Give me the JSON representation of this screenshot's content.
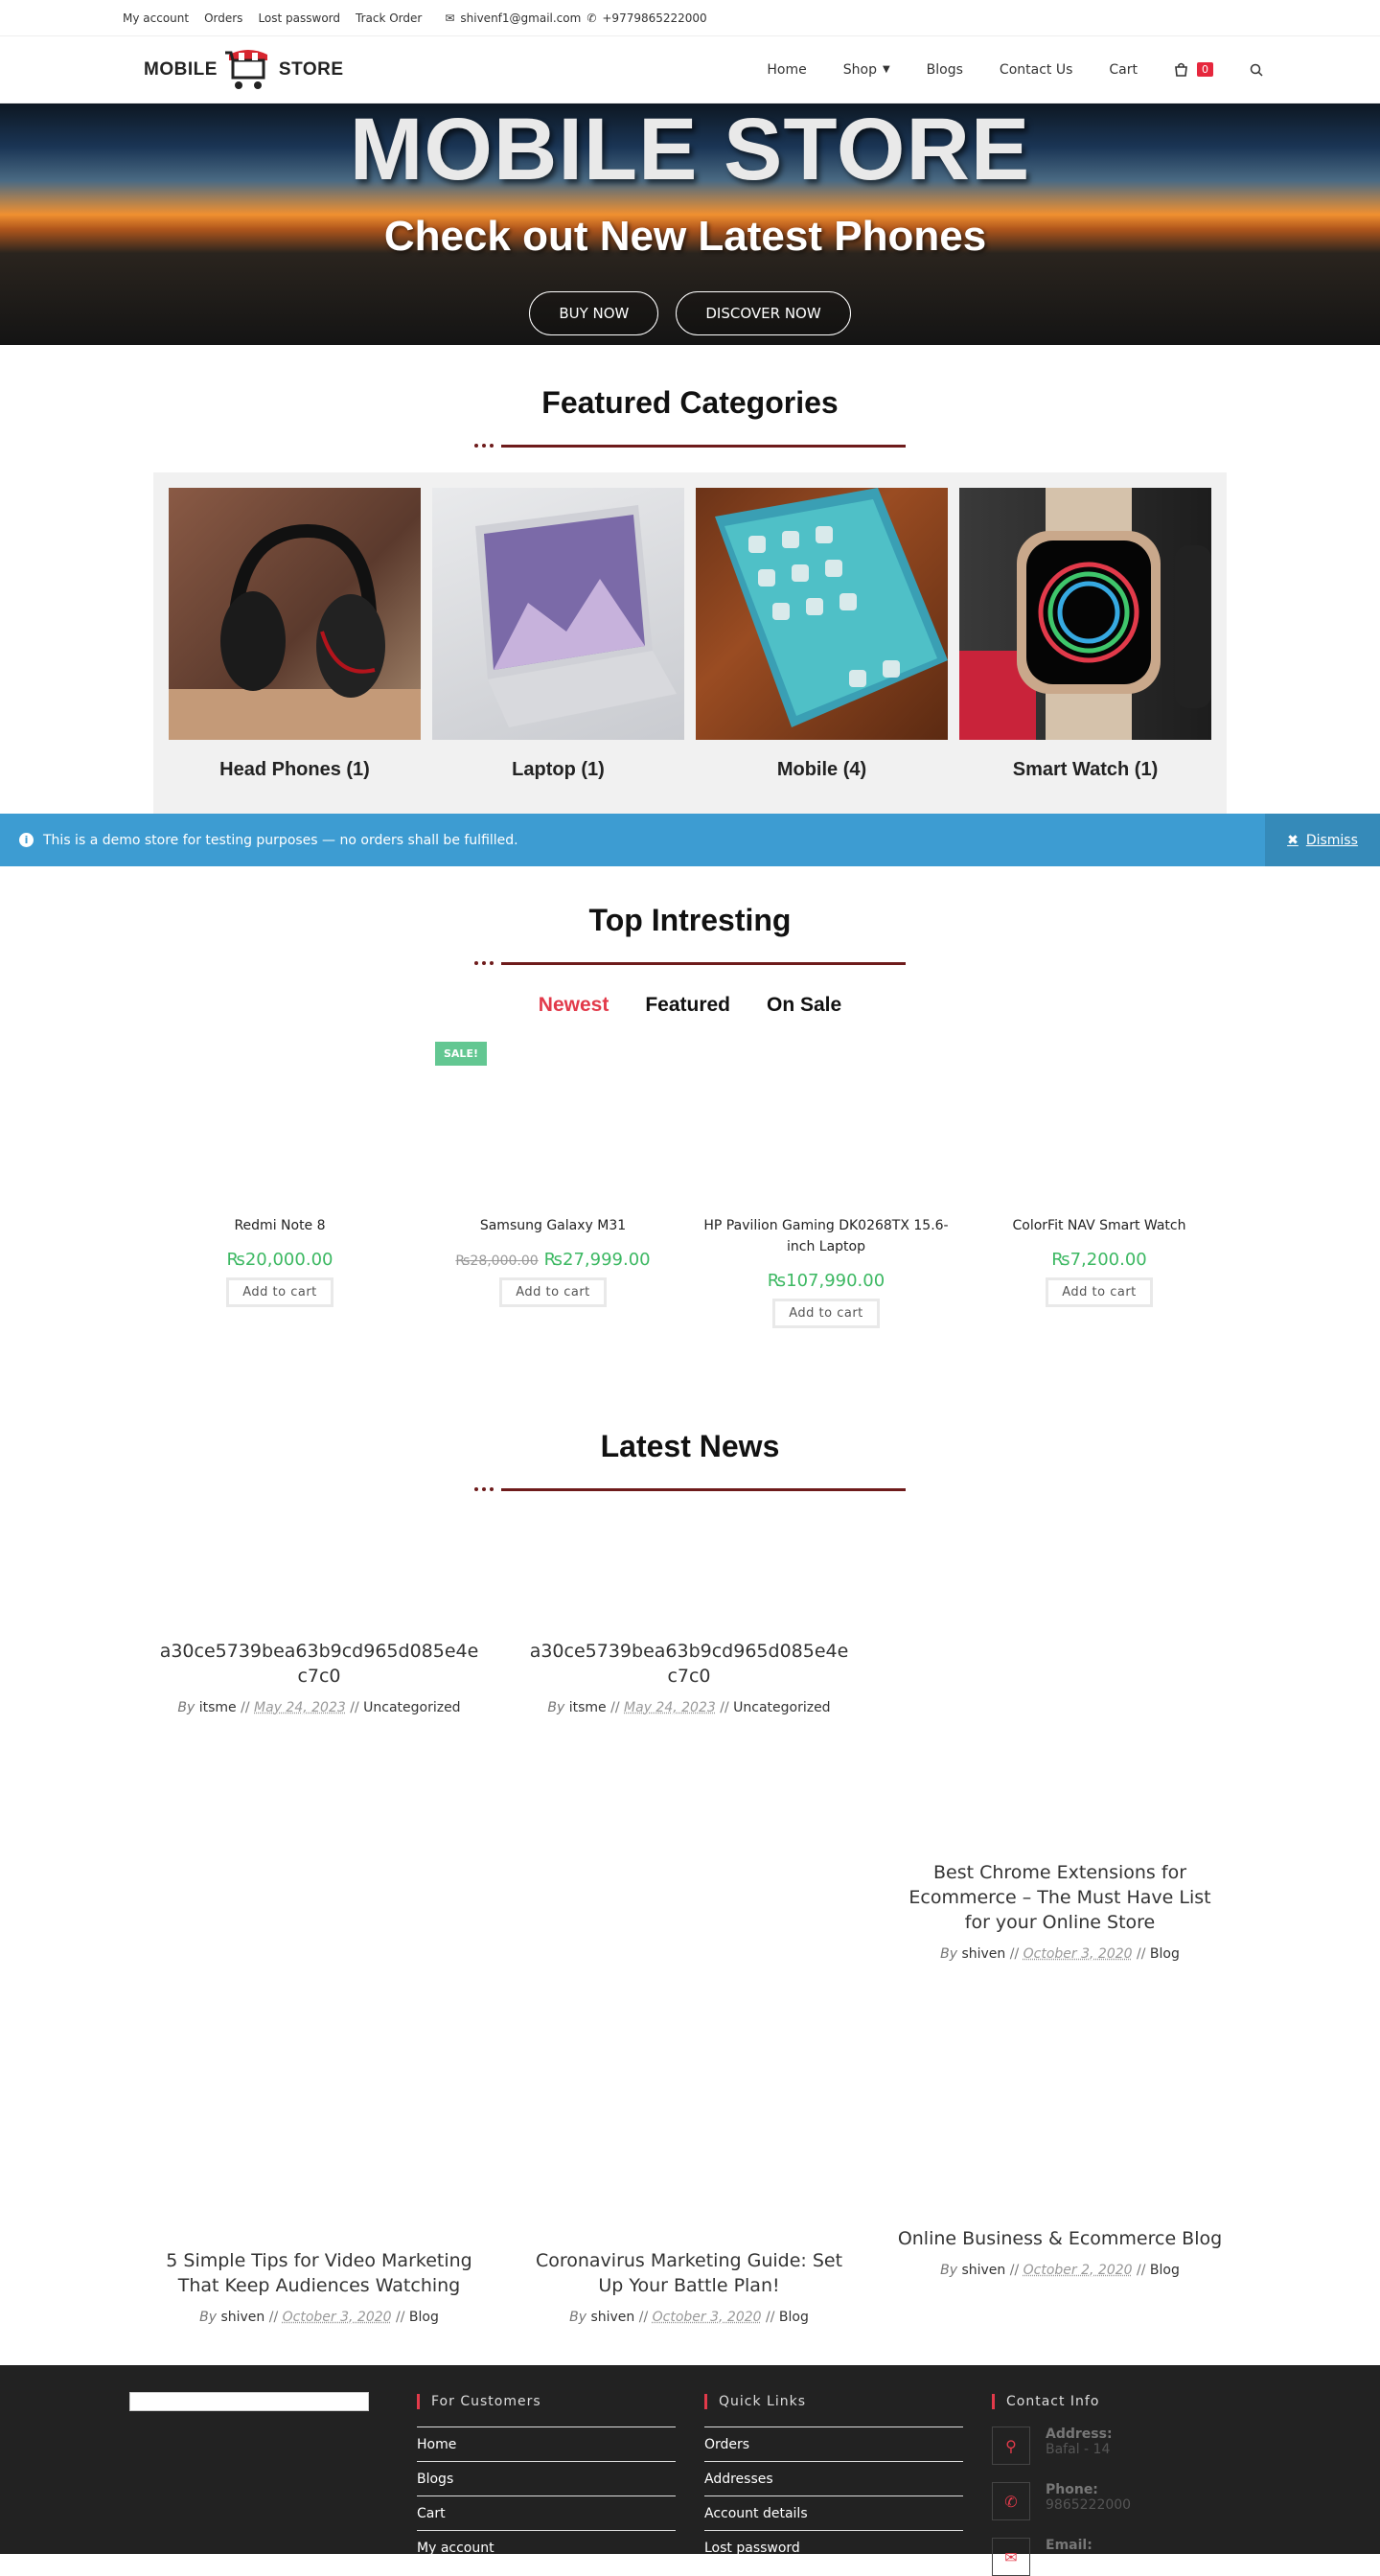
{
  "topbar": {
    "links": [
      "My account",
      "Orders",
      "Lost password",
      "Track Order"
    ],
    "email": "shivenf1@gmail.com",
    "phone": "+9779865222000"
  },
  "header": {
    "logo_left": "MOBILE",
    "logo_right": "STORE",
    "nav": {
      "home": "Home",
      "shop": "Shop",
      "blogs": "Blogs",
      "contact": "Contact Us",
      "cart": "Cart",
      "cart_count": "0"
    }
  },
  "hero": {
    "title": "MOBILE STORE",
    "subtitle": "Check out New Latest Phones",
    "buy_now": "BUY NOW",
    "discover_now": "DISCOVER NOW"
  },
  "featured": {
    "title": "Featured Categories",
    "categories": [
      "Head Phones (1)",
      "Laptop (1)",
      "Mobile (4)",
      "Smart Watch (1)"
    ]
  },
  "notice": {
    "text": "This is a demo store for testing purposes — no orders shall be fulfilled.",
    "dismiss": "Dismiss"
  },
  "top": {
    "title": "Top Intresting",
    "tabs": [
      "Newest",
      "Featured",
      "On Sale"
    ],
    "sale_badge": "SALE!",
    "add_to_cart": "Add to cart",
    "products": [
      {
        "name": "Redmi Note 8",
        "price": "₨20,000.00",
        "old_price": ""
      },
      {
        "name": "Samsung Galaxy M31",
        "price": "₨27,999.00",
        "old_price": "₨28,000.00"
      },
      {
        "name": "HP Pavilion Gaming DK0268TX 15.6-inch Laptop",
        "price": "₨107,990.00",
        "old_price": ""
      },
      {
        "name": "ColorFit NAV Smart Watch",
        "price": "₨7,200.00",
        "old_price": ""
      }
    ]
  },
  "news": {
    "title": "Latest News",
    "by": "By",
    "posts": [
      {
        "title": "a30ce5739bea63b9cd965d085e4ec7c0",
        "author": "itsme",
        "date": "May 24, 2023",
        "category": "Uncategorized"
      },
      {
        "title": "a30ce5739bea63b9cd965d085e4ec7c0",
        "author": "itsme",
        "date": "May 24, 2023",
        "category": "Uncategorized"
      },
      {
        "title": "Best Chrome Extensions for Ecommerce – The Must Have List for your Online Store",
        "author": "shiven",
        "date": "October 3, 2020",
        "category": "Blog"
      },
      {
        "title": "5 Simple Tips for Video Marketing That Keep Audiences Watching",
        "author": "shiven",
        "date": "October 3, 2020",
        "category": "Blog"
      },
      {
        "title": "Coronavirus Marketing Guide: Set Up Your Battle Plan!",
        "author": "shiven",
        "date": "October 3, 2020",
        "category": "Blog"
      },
      {
        "title": "Online Business & Ecommerce Blog",
        "author": "shiven",
        "date": "October 2, 2020",
        "category": "Blog"
      }
    ]
  },
  "footer": {
    "customers": {
      "title": "For Customers",
      "links": [
        "Home",
        "Blogs",
        "Cart",
        "My account"
      ]
    },
    "quick": {
      "title": "Quick Links",
      "links": [
        "Orders",
        "Addresses",
        "Account details",
        "Lost password"
      ]
    },
    "contact": {
      "title": "Contact Info",
      "address_label": "Address:",
      "address": "Bafal - 14",
      "phone_label": "Phone:",
      "phone": "9865222000",
      "email_label": "Email:"
    }
  },
  "colors": {
    "accent": "#e23a4a",
    "divider": "#6e1b1b",
    "price": "#3cb862",
    "notice": "#3d9cd2",
    "footer": "#222222"
  }
}
